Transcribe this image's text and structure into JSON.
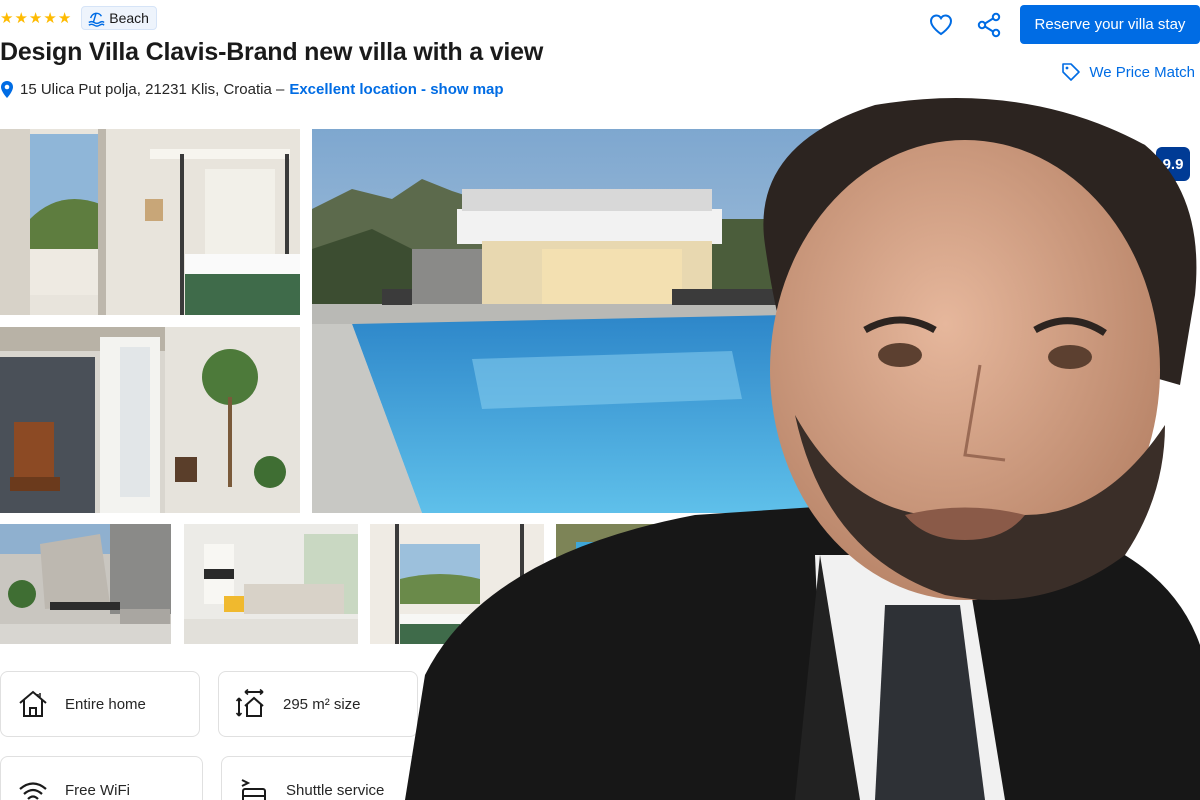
{
  "header": {
    "star_count": 5,
    "badge_label": "Beach",
    "title": "Design Villa Clavis-Brand new villa with a view",
    "address": "15 Ulica Put polja, 21231 Klis, Croatia –",
    "location_link": "Excellent location - show map"
  },
  "actions": {
    "reserve_label": "Reserve your villa stay",
    "price_match_label": "We Price Match"
  },
  "review": {
    "score_partial": "9.9"
  },
  "facilities": [
    {
      "label": "Entire home",
      "icon": "house-icon"
    },
    {
      "label": "295 m² size",
      "icon": "size-icon"
    },
    {
      "label": "Free WiFi",
      "icon": "wifi-icon"
    },
    {
      "label": "Shuttle service",
      "icon": "shuttle-icon"
    }
  ],
  "colors": {
    "accent": "#006ce4",
    "star": "#febb02",
    "score": "#003b95"
  }
}
